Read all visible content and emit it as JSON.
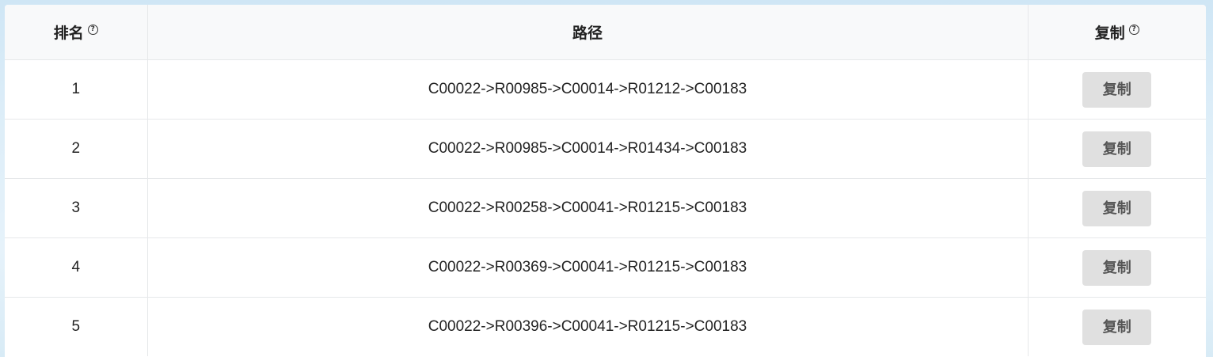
{
  "table": {
    "headers": {
      "rank": "排名",
      "path": "路径",
      "copy": "复制"
    },
    "help_icon_glyph": "?",
    "rows": [
      {
        "rank": "1",
        "path": "C00022->R00985->C00014->R01212->C00183",
        "copy_label": "复制"
      },
      {
        "rank": "2",
        "path": "C00022->R00985->C00014->R01434->C00183",
        "copy_label": "复制"
      },
      {
        "rank": "3",
        "path": "C00022->R00258->C00041->R01215->C00183",
        "copy_label": "复制"
      },
      {
        "rank": "4",
        "path": "C00022->R00369->C00041->R01215->C00183",
        "copy_label": "复制"
      },
      {
        "rank": "5",
        "path": "C00022->R00396->C00041->R01215->C00183",
        "copy_label": "复制"
      }
    ]
  },
  "colors": {
    "header_bg": "#f8f9fa",
    "button_bg": "#e0e0e0",
    "border": "#e6e8ea"
  }
}
